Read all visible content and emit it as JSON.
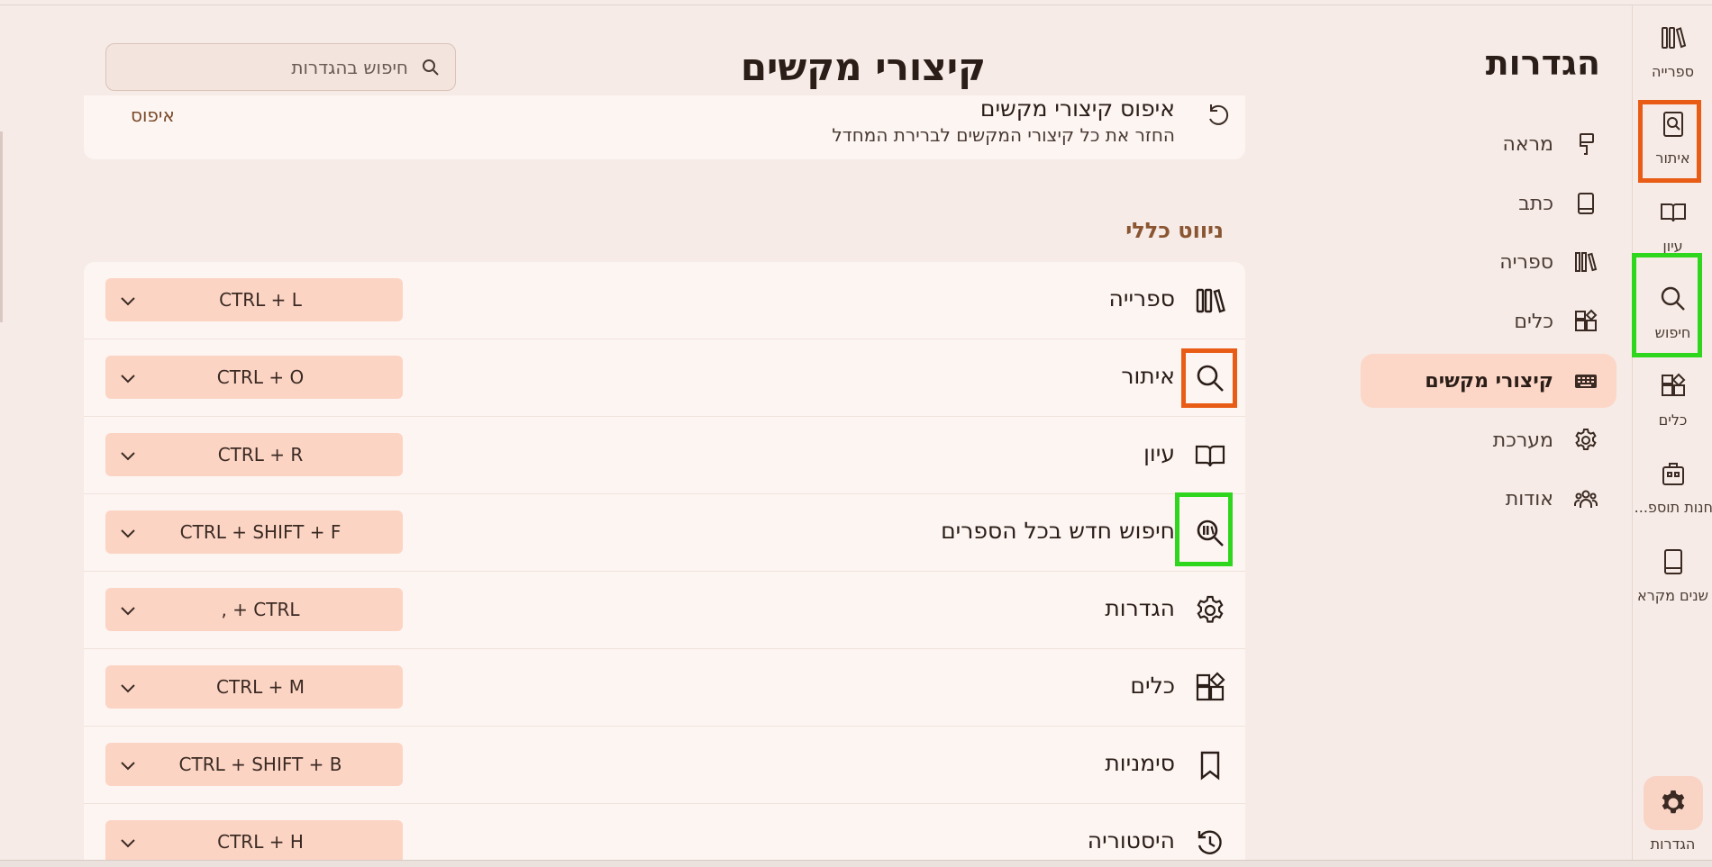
{
  "rail": {
    "items": [
      {
        "label": "ספרייה",
        "icon": "library-icon"
      },
      {
        "label": "איתור",
        "icon": "find-book-icon"
      },
      {
        "label": "עיון",
        "icon": "open-book-icon"
      },
      {
        "label": "חיפוש",
        "icon": "search-icon"
      },
      {
        "label": "כלים",
        "icon": "tools-icon"
      },
      {
        "label": "חנות תוספ...",
        "icon": "store-icon"
      },
      {
        "label": "שנים מקרא",
        "icon": "book-icon"
      }
    ],
    "settings_label": "הגדרות"
  },
  "settings_nav": {
    "title": "הגדרות",
    "items": [
      {
        "label": "מראה",
        "icon": "paint-brush-icon"
      },
      {
        "label": "כתב",
        "icon": "book-icon"
      },
      {
        "label": "ספריה",
        "icon": "library-icon"
      },
      {
        "label": "כלים",
        "icon": "tools-icon"
      },
      {
        "label": "קיצורי מקשים",
        "icon": "keyboard-icon",
        "active": true
      },
      {
        "label": "מערכת",
        "icon": "gear-icon"
      },
      {
        "label": "אודות",
        "icon": "people-icon"
      }
    ]
  },
  "main": {
    "title": "קיצורי מקשים",
    "search": {
      "placeholder": "חיפוש בהגדרות"
    },
    "reset": {
      "title": "איפוס קיצורי מקשים",
      "subtitle": "החזר את כל קיצורי המקשים לברירת המחדל",
      "button": "איפוס"
    },
    "section_title": "ניווט כללי",
    "shortcuts": [
      {
        "label": "ספרייה",
        "keys": "CTRL + L",
        "icon": "library-icon"
      },
      {
        "label": "איתור",
        "keys": "CTRL + O",
        "icon": "search-icon"
      },
      {
        "label": "עיון",
        "keys": "CTRL + R",
        "icon": "open-book-icon"
      },
      {
        "label": "חיפוש חדש בכל הספרים",
        "keys": "CTRL + SHIFT + F",
        "icon": "search-all-books-icon"
      },
      {
        "label": "הגדרות",
        "keys": ", + CTRL",
        "icon": "gear-icon"
      },
      {
        "label": "כלים",
        "keys": "CTRL + M",
        "icon": "tools-icon"
      },
      {
        "label": "סימניות",
        "keys": "CTRL + SHIFT + B",
        "icon": "bookmark-icon"
      },
      {
        "label": "היסטוריה",
        "keys": "CTRL + H",
        "icon": "history-icon"
      }
    ]
  },
  "colors": {
    "background": "#f6ebe6",
    "card": "#fdf5f2",
    "accent_chip": "#fcd4c4",
    "section_title": "#8a5532",
    "highlight_orange": "#e85c15",
    "highlight_green": "#2fd61e"
  }
}
